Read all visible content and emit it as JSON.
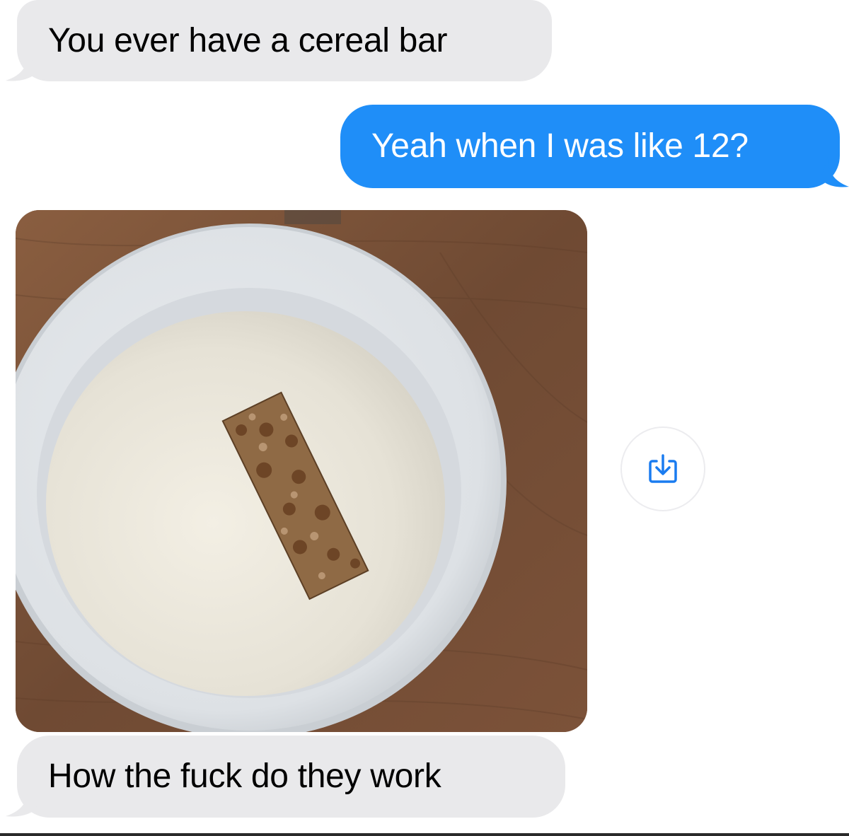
{
  "messages": {
    "msg1": "You ever have a cereal bar",
    "msg2": "Yeah when I was like 12?",
    "msg4": "How the fuck do they work"
  },
  "icons": {
    "save": "save-download-icon"
  },
  "colors": {
    "incoming_bubble": "#e9e9eb",
    "outgoing_bubble": "#1f8ef8",
    "icon_accent": "#1a7cf0"
  }
}
